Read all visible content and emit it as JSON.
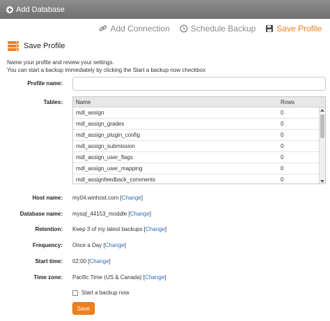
{
  "titlebar": {
    "title": "Add Database"
  },
  "wizard": {
    "steps": [
      {
        "label": "Add Connection",
        "icon": "link-icon"
      },
      {
        "label": "Schedule Backup",
        "icon": "clock-icon"
      },
      {
        "label": "Save Profile",
        "icon": "save-icon",
        "active": true
      }
    ]
  },
  "section": {
    "title": "Save Profile",
    "icon": "server-stack-icon"
  },
  "intro": {
    "line1": "Name your profile and review your settings.",
    "line2": "You can start a backup immediately by clicking the Start a backup now checkbox"
  },
  "form": {
    "profile_name_label": "Profile name:",
    "profile_name_value": "",
    "tables_label": "Tables:",
    "host_label": "Host name:",
    "host_value": "my04.winhost.com",
    "db_label": "Database name:",
    "db_value": "mysql_44153_moddle",
    "retention_label": "Retention:",
    "retention_value": "Keep 3 of my latest backups",
    "frequency_label": "Frequency:",
    "frequency_value": "Once a Day",
    "start_label": "Start time:",
    "start_value": "02:00",
    "tz_label": "Time zone:",
    "tz_value": "Pacific Time (US & Canada)",
    "change_open": "[",
    "change_text": "Change",
    "change_close": "]",
    "start_backup_label": "Start a backup now",
    "save_label": "Save"
  },
  "tables": {
    "headers": {
      "name": "Name",
      "rows": "Rows"
    },
    "rows": [
      {
        "name": "mdl_assign",
        "rows": "0"
      },
      {
        "name": "mdl_assign_grades",
        "rows": "0"
      },
      {
        "name": "mdl_assign_plugin_config",
        "rows": "0"
      },
      {
        "name": "mdl_assign_submission",
        "rows": "0"
      },
      {
        "name": "mdl_assign_user_flags",
        "rows": "0"
      },
      {
        "name": "mdl_assign_user_mapping",
        "rows": "0"
      },
      {
        "name": "mdl_assignfeedback_comments",
        "rows": "0"
      }
    ]
  },
  "colors": {
    "accent": "#f07f1e",
    "link": "#2a6db5",
    "titlebar": "#7a7a7a"
  }
}
